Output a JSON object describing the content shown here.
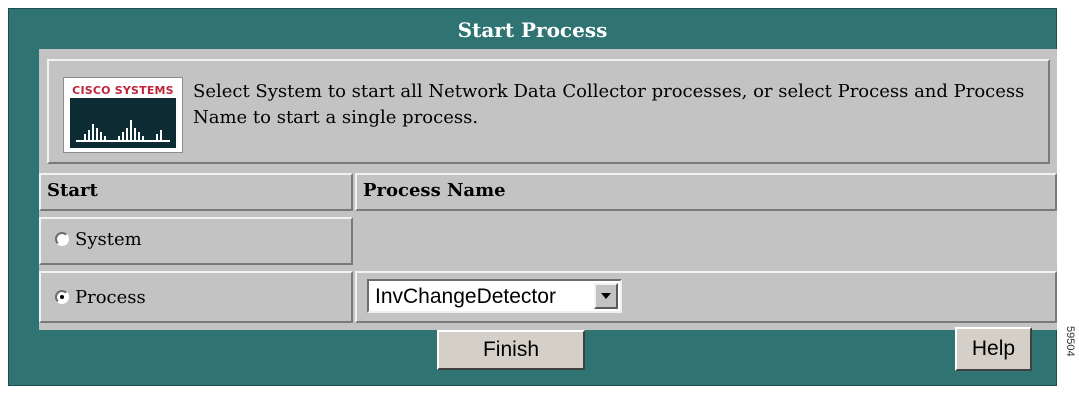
{
  "window": {
    "title": "Start Process"
  },
  "info": {
    "logo_text": "CISCO SYSTEMS",
    "logo_icon": "cisco-bridge-logo",
    "text": "Select System to start all Network Data Collector processes, or select Process and Process Name to start a single process."
  },
  "table": {
    "headers": [
      "Start",
      "Process Name"
    ],
    "options": [
      {
        "label": "System",
        "checked": false
      },
      {
        "label": "Process",
        "checked": true
      }
    ],
    "process_select": {
      "value": "InvChangeDetector"
    }
  },
  "buttons": {
    "finish": "Finish",
    "help": "Help"
  },
  "figure_id": "59504",
  "colors": {
    "background": "#2f7473",
    "panel": "#c3c3c3",
    "logo_red": "#c0243a",
    "logo_dark": "#0d2b33"
  }
}
